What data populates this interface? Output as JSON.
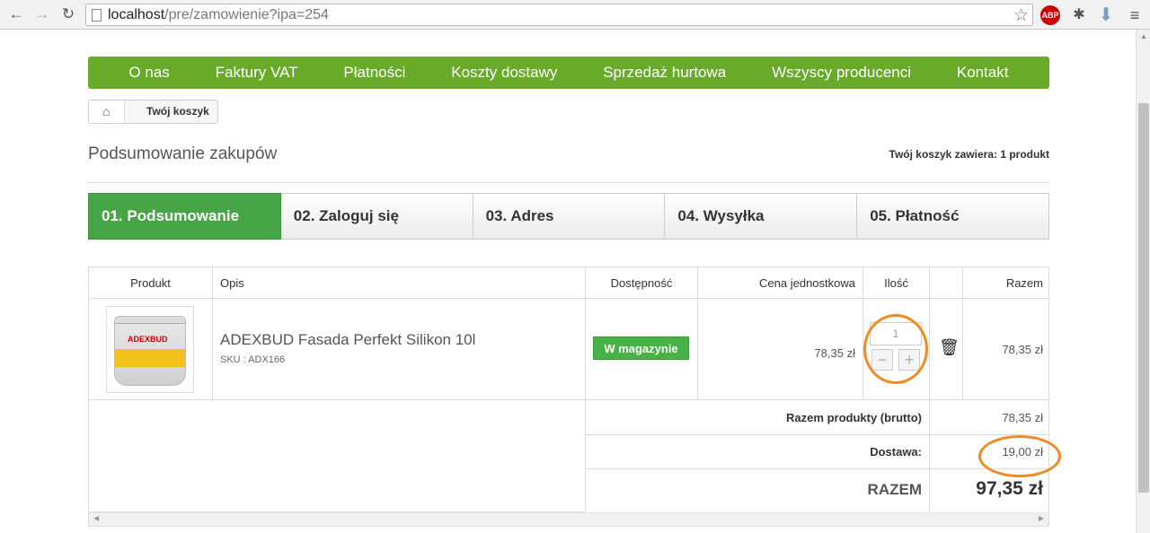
{
  "browser": {
    "url_host": "localhost",
    "url_path": "/pre/zamowienie?ipa=254",
    "abp_label": "ABP"
  },
  "menu": {
    "items": [
      "O nas",
      "Faktury VAT",
      "Płatności",
      "Koszty dostawy",
      "Sprzedaż hurtowa",
      "Wszyscy producenci",
      "Kontakt"
    ]
  },
  "breadcrumb": {
    "current": "Twój koszyk"
  },
  "summary": {
    "title": "Podsumowanie zakupów",
    "cart_count": "Twój koszyk zawiera: 1 produkt"
  },
  "steps": [
    "01. Podsumowanie",
    "02. Zaloguj się",
    "03. Adres",
    "04. Wysyłka",
    "05. Płatność"
  ],
  "table": {
    "headers": [
      "Produkt",
      "Opis",
      "Dostępność",
      "Cena jednostkowa",
      "Ilość",
      "",
      "Razem"
    ],
    "item": {
      "image_label": "ADEXBUD",
      "name": "ADEXBUD Fasada Perfekt Silikon 10l",
      "sku": "SKU : ADX166",
      "availability": "W magazynie",
      "unit_price": "78,35 zł",
      "quantity": "1",
      "minus": "−",
      "plus": "+",
      "total": "78,35 zł"
    },
    "totals": {
      "products_label": "Razem produkty (brutto)",
      "products_value": "78,35 zł",
      "shipping_label": "Dostawa:",
      "shipping_value": "19,00 zł",
      "grand_label": "RAZEM",
      "grand_value": "97,35 zł"
    }
  },
  "colors": {
    "menu_green": "#6aaa2a",
    "step_active": "#47a447",
    "annotation_orange": "#f08a24"
  }
}
